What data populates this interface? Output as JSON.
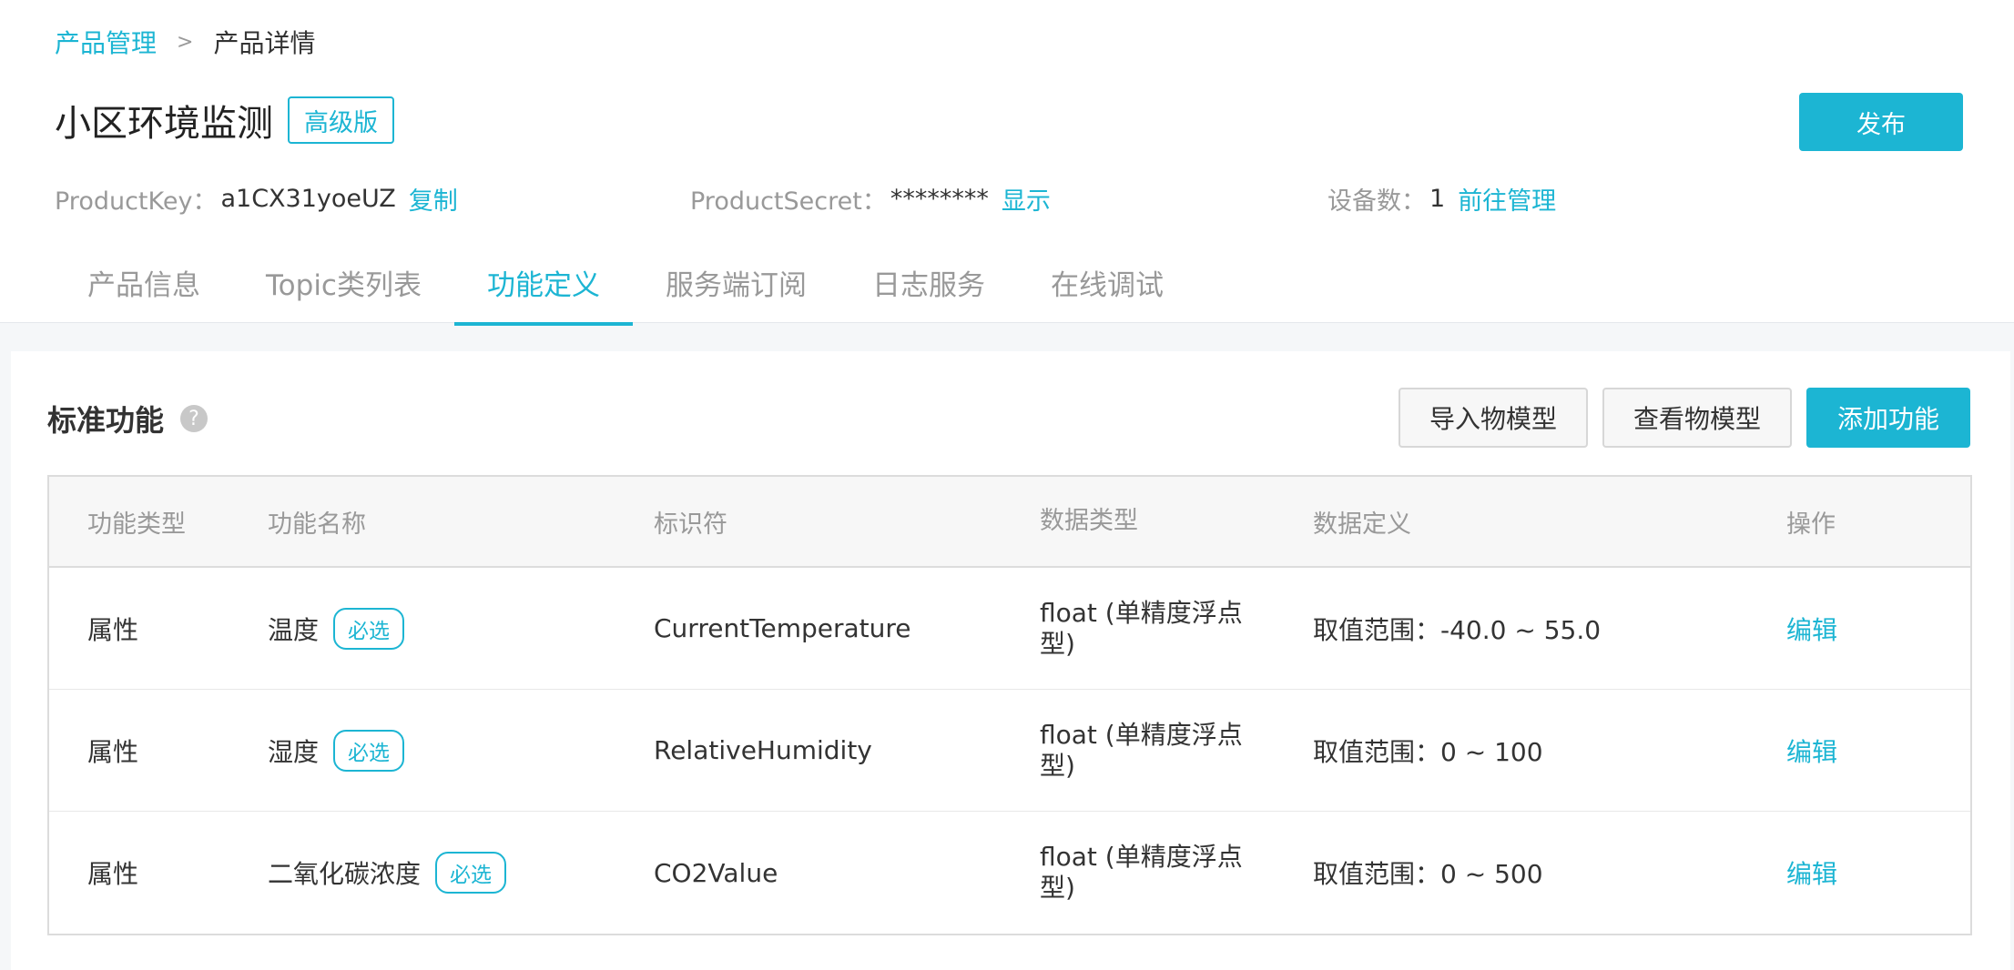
{
  "breadcrumb": {
    "parent": "产品管理",
    "separator": ">",
    "current": "产品详情"
  },
  "product": {
    "name": "小区环境监测",
    "edition": "高级版",
    "publish_label": "发布"
  },
  "meta": {
    "product_key_label": "ProductKey：",
    "product_key_value": "a1CX31yoeUZ",
    "product_key_action": "复制",
    "product_secret_label": "ProductSecret：",
    "product_secret_value": "********",
    "product_secret_action": "显示",
    "device_count_label": "设备数：",
    "device_count_value": "1",
    "device_count_action": "前往管理"
  },
  "tabs": [
    {
      "label": "产品信息",
      "active": false
    },
    {
      "label": "Topic类列表",
      "active": false
    },
    {
      "label": "功能定义",
      "active": true
    },
    {
      "label": "服务端订阅",
      "active": false
    },
    {
      "label": "日志服务",
      "active": false
    },
    {
      "label": "在线调试",
      "active": false
    }
  ],
  "panel": {
    "title": "标准功能",
    "help_icon": "question-circle-icon",
    "help_glyph": "?",
    "import_label": "导入物模型",
    "view_label": "查看物模型",
    "add_label": "添加功能"
  },
  "table": {
    "headers": {
      "type": "功能类型",
      "name": "功能名称",
      "identifier": "标识符",
      "data_type": "数据类型",
      "data_definition": "数据定义",
      "action": "操作"
    },
    "rows": [
      {
        "type": "属性",
        "name": "温度",
        "tag": "必选",
        "identifier": "CurrentTemperature",
        "data_type": "float (单精度浮点型)",
        "data_definition": "取值范围：-40.0 ~ 55.0",
        "action": "编辑"
      },
      {
        "type": "属性",
        "name": "湿度",
        "tag": "必选",
        "identifier": "RelativeHumidity",
        "data_type": "float (单精度浮点型)",
        "data_definition": "取值范围：0 ~ 100",
        "action": "编辑"
      },
      {
        "type": "属性",
        "name": "二氧化碳浓度",
        "tag": "必选",
        "identifier": "CO2Value",
        "data_type": "float (单精度浮点型)",
        "data_definition": "取值范围：0 ~ 500",
        "action": "编辑"
      }
    ]
  },
  "colors": {
    "accent": "#1cb5d3",
    "muted_text": "#999999",
    "body_text": "#333333",
    "page_background": "#f5f7f9"
  }
}
